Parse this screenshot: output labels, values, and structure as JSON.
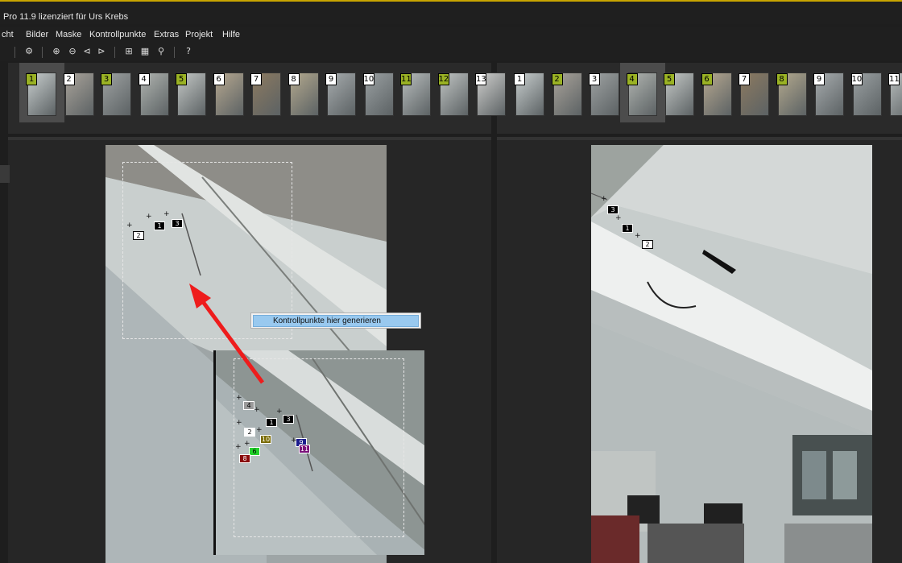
{
  "window": {
    "title": "Pro 11.9 lizenziert für Urs Krebs"
  },
  "menu": {
    "items": [
      "cht",
      "Bilder",
      "Maske",
      "Kontrollpunkte",
      "Extras",
      "Projekt",
      "Hilfe"
    ]
  },
  "toolbar": {
    "icons": [
      "gear-icon",
      "zoom-in-icon",
      "zoom-out-icon",
      "previous-icon",
      "next-icon",
      "panorama-icon",
      "grid-icon",
      "pin-icon",
      "help-icon"
    ],
    "glyphs": [
      "⚙",
      "⊕",
      "⊖",
      "⊲",
      "⊳",
      "⊞",
      "▦",
      "⚲",
      "?"
    ]
  },
  "strip_left": {
    "numbers": [
      "1",
      "2",
      "3",
      "4",
      "5",
      "6",
      "7",
      "8",
      "9",
      "10",
      "11",
      "12",
      "13"
    ],
    "green": [
      true,
      false,
      true,
      false,
      true,
      false,
      false,
      false,
      false,
      false,
      true,
      true,
      false
    ],
    "selected_index": 0
  },
  "strip_right": {
    "numbers": [
      "1",
      "2",
      "3",
      "4",
      "5",
      "6",
      "7",
      "8",
      "9",
      "10",
      "11"
    ],
    "green": [
      false,
      true,
      false,
      true,
      true,
      true,
      false,
      true,
      false,
      false,
      false
    ],
    "selected_index": 3
  },
  "left_points": [
    {
      "label": "2",
      "style": "white"
    },
    {
      "label": "1",
      "style": "black"
    },
    {
      "label": "3",
      "style": "black"
    }
  ],
  "right_points": [
    {
      "label": "3",
      "style": "black"
    },
    {
      "label": "1",
      "style": "black"
    },
    {
      "label": "2",
      "style": "white"
    }
  ],
  "inset_points": [
    {
      "label": "4",
      "bg": "#9a9a9a",
      "fg": "#000"
    },
    {
      "label": "3",
      "bg": "#000000",
      "fg": "#fff"
    },
    {
      "label": "1",
      "bg": "#000000",
      "fg": "#fff"
    },
    {
      "label": "2",
      "bg": "#ffffff",
      "fg": "#000"
    },
    {
      "label": "10",
      "bg": "#7a6b00",
      "fg": "#fff"
    },
    {
      "label": "9",
      "bg": "#1a1a8c",
      "fg": "#fff"
    },
    {
      "label": "11",
      "bg": "#7a127a",
      "fg": "#fff"
    },
    {
      "label": "6",
      "bg": "#22d22a",
      "fg": "#000"
    },
    {
      "label": "8",
      "bg": "#8a0a0a",
      "fg": "#fff"
    }
  ],
  "context_menu": {
    "item": "Kontrollpunkte hier generieren"
  },
  "colors": {
    "accent_green": "#9ab224",
    "arrow": "#ee1c1c",
    "menu_highlight": "#99c9ef"
  }
}
